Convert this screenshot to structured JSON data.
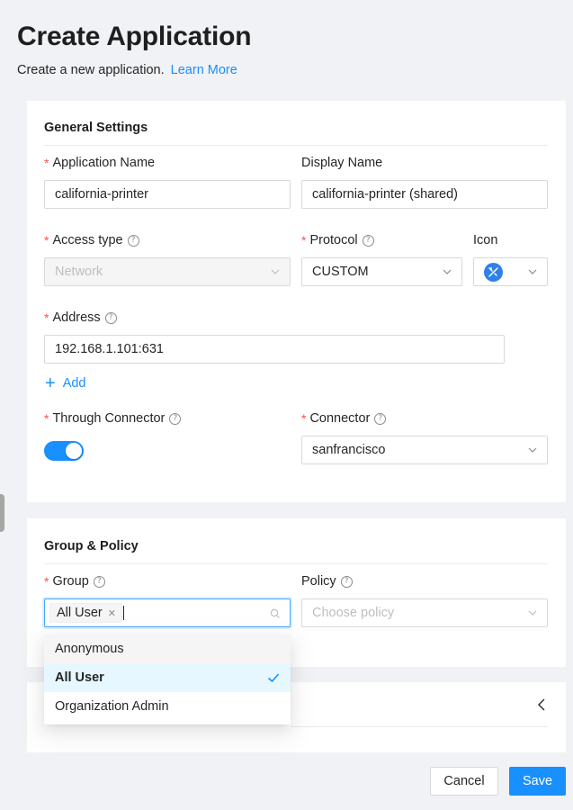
{
  "header": {
    "title": "Create Application",
    "description": "Create a new application.",
    "learn_more": "Learn More"
  },
  "general": {
    "title": "General Settings",
    "app_name_label": "Application Name",
    "app_name_value": "california-printer",
    "display_name_label": "Display Name",
    "display_name_value": "california-printer (shared)",
    "access_type_label": "Access type",
    "access_type_value": "Network",
    "protocol_label": "Protocol",
    "protocol_value": "CUSTOM",
    "icon_label": "Icon",
    "address_label": "Address",
    "address_value": "192.168.1.101:631",
    "add_label": "Add",
    "through_connector_label": "Through Connector",
    "through_connector_on": true,
    "connector_label": "Connector",
    "connector_value": "sanfrancisco"
  },
  "group_policy": {
    "title": "Group & Policy",
    "group_label": "Group",
    "group_tags": [
      "All User"
    ],
    "policy_label": "Policy",
    "policy_placeholder": "Choose policy",
    "group_options": [
      {
        "label": "Anonymous",
        "state": "hover"
      },
      {
        "label": "All User",
        "state": "selected"
      },
      {
        "label": "Organization Admin",
        "state": "normal"
      }
    ]
  },
  "footer": {
    "cancel": "Cancel",
    "save": "Save"
  },
  "colors": {
    "primary": "#1890ff",
    "required": "#ff4d4f",
    "background": "#f0f2f5"
  }
}
